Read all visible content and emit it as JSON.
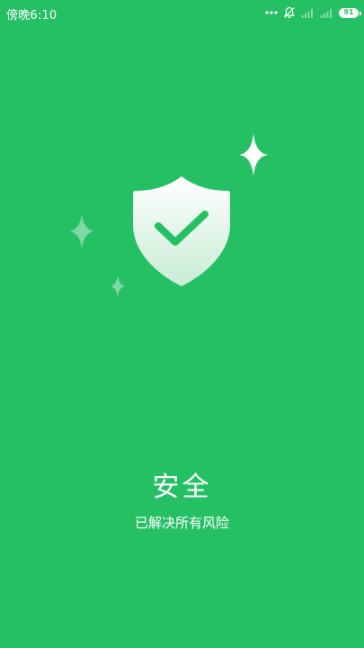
{
  "status_bar": {
    "time": "傍晚6:10",
    "battery_level": "91",
    "icons": [
      "more-dots-icon",
      "notification-muted-icon",
      "signal-icon",
      "signal-icon",
      "battery-icon"
    ]
  },
  "hero": {
    "icon": "shield-check-icon",
    "decorations": [
      "sparkle-icon",
      "sparkle-icon",
      "sparkle-icon"
    ]
  },
  "result": {
    "title": "安全",
    "subtitle": "已解决所有风险"
  },
  "colors": {
    "background": "#26c064",
    "text": "#ffffff",
    "check": "#26c064"
  }
}
